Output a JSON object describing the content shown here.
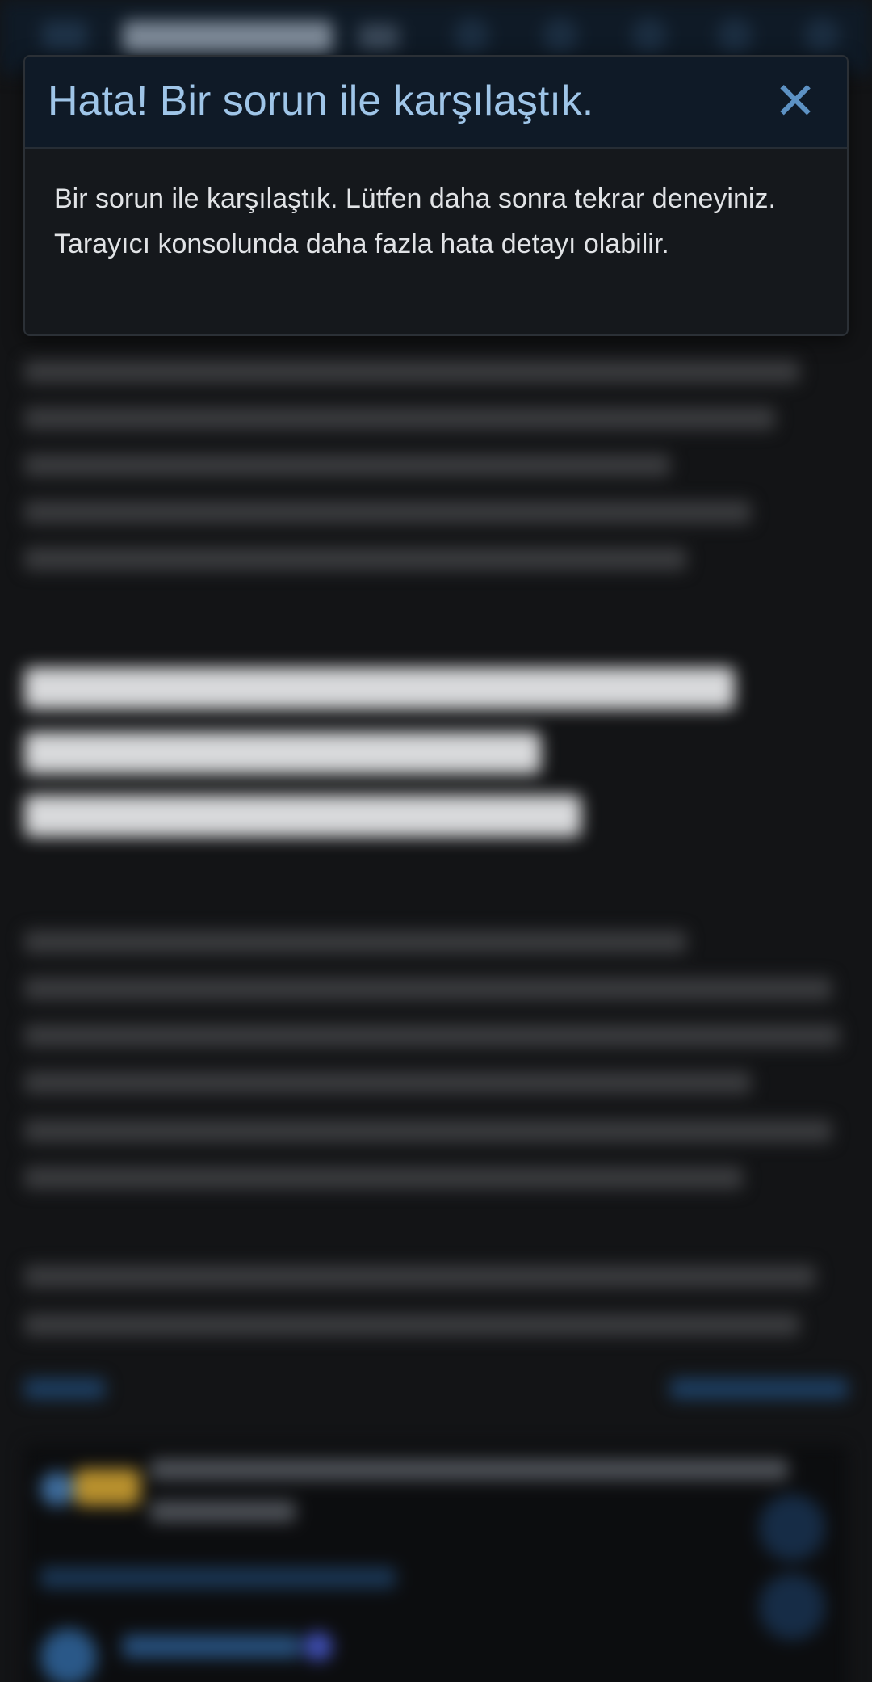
{
  "dialog": {
    "title": "Hata! Bir sorun ile karşılaştık.",
    "close_glyph": "✕",
    "message": "Bir sorun ile karşılaştık. Lütfen daha sonra tekrar deneyiniz. Tarayıcı konsolunda daha fazla hata detayı olabilir."
  },
  "colors": {
    "dialog_title": "#9fc5e8",
    "dialog_close": "#5d92c4",
    "dialog_header_bg": "#0f1a27",
    "dialog_body_bg": "#15181c",
    "page_bg": "#131416"
  },
  "icons": {
    "close": "close-icon",
    "menu": "hamburger-menu-icon"
  }
}
